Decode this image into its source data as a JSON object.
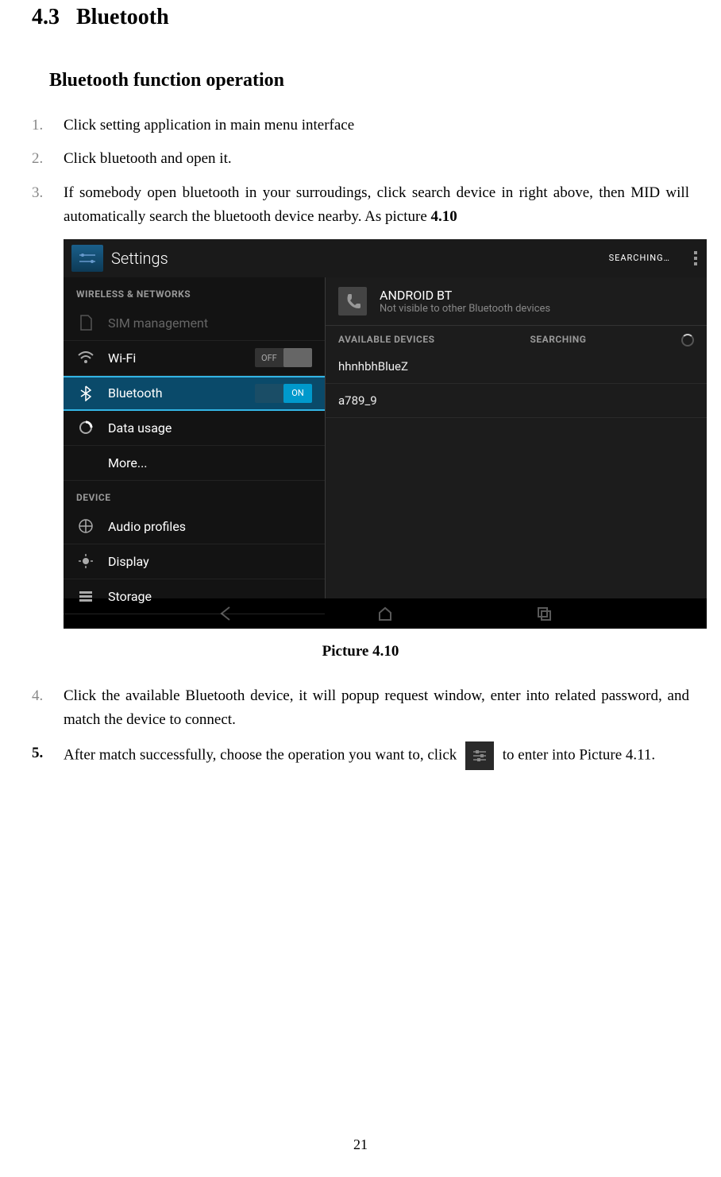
{
  "heading": {
    "number": "4.3",
    "title": "Bluetooth"
  },
  "subsection": "Bluetooth function operation",
  "steps": {
    "s1": {
      "num": "1.",
      "text": "Click setting application in main menu interface"
    },
    "s2": {
      "num": "2.",
      "text": "Click bluetooth and open it."
    },
    "s3": {
      "num": "3.",
      "text_a": "If somebody open bluetooth in your surroudings, click search device in right above, then MID will automatically search the bluetooth device nearby. As picture ",
      "text_b": "4.10"
    },
    "s4": {
      "num": "4.",
      "text": "Click the available Bluetooth device, it will popup request window, enter into related password, and match the device to connect."
    },
    "s5": {
      "num": "5.",
      "text_a": "After match successfully, choose the operation you want to, click ",
      "text_b": " to enter into Picture 4.11."
    }
  },
  "caption": "Picture 4.10",
  "page_number": "21",
  "screenshot": {
    "header_title": "Settings",
    "header_status": "SEARCHING…",
    "sidebar": {
      "section1": "WIRELESS & NETWORKS",
      "sim": "SIM management",
      "wifi": "Wi-Fi",
      "wifi_toggle": "OFF",
      "bluetooth": "Bluetooth",
      "bluetooth_toggle": "ON",
      "data": "Data usage",
      "more": "More...",
      "section2": "DEVICE",
      "audio": "Audio profiles",
      "display": "Display",
      "storage": "Storage"
    },
    "main": {
      "device_name": "ANDROID BT",
      "device_sub": "Not visible to other Bluetooth devices",
      "available": "AVAILABLE DEVICES",
      "searching": "SEARCHING",
      "devices": {
        "d1": "hhnhbhBlueZ",
        "d2": "a789_9"
      }
    }
  }
}
